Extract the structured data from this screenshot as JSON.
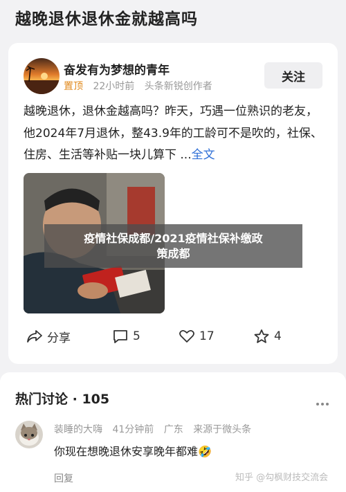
{
  "page": {
    "title": "越晚退休退休金就越高吗"
  },
  "post": {
    "author": "奋发有为梦想的青年",
    "pin_label": "置顶",
    "time": "22小时前",
    "source": "头条新锐创作者",
    "follow_label": "关注",
    "body": "越晚退休，退休金越高吗？昨天，巧遇一位熟识的老友，他2024年7月退休，整43.9年的工龄可不是吹的，社保、住房、生活等补贴一块儿算下 ...",
    "full_text_label": "全文",
    "share_label": "分享",
    "comment_count": "5",
    "like_count": "17",
    "favorite_count": "4"
  },
  "overlay": {
    "line1": "疫情社保成都/2021疫情社保补缴政",
    "line2": "策成都"
  },
  "discussion": {
    "heading": "热门讨论 · 105",
    "comment": {
      "user": "装睡的大嗨",
      "time": "41分钟前",
      "location": "广东",
      "source": "来源于微头条",
      "text": "你现在想晚退休安享晚年都难🤣",
      "reply_label": "回复"
    },
    "watermark": "知乎 @勾枫财技交流会"
  },
  "icons": {
    "share": "share-arrow-icon",
    "comment": "comment-bubble-icon",
    "like": "heart-icon",
    "favorite": "star-icon",
    "more": "more-dots-icon"
  }
}
